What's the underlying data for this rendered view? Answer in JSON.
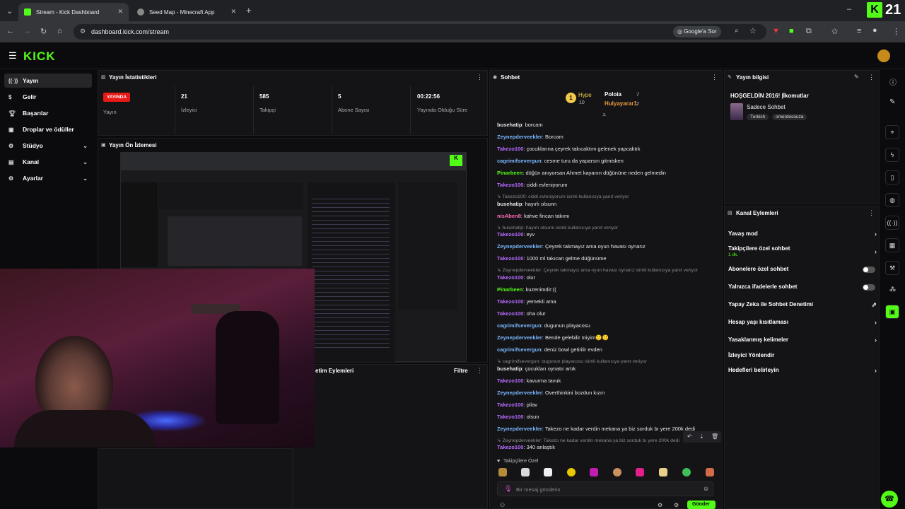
{
  "browser": {
    "tabs": [
      {
        "label": "Stream - Kick Dashboard"
      },
      {
        "label": "Seed Map - Minecraft App"
      }
    ],
    "url": "dashboard.kick.com/stream",
    "google_btn": "Google'a Sor",
    "corner_badge": "21"
  },
  "header": {
    "logo": "KICK"
  },
  "sidebar": {
    "items": [
      {
        "label": "Yayın"
      },
      {
        "label": "Gelir"
      },
      {
        "label": "Başarılar"
      },
      {
        "label": "Droplar ve ödüller"
      },
      {
        "label": "Stüdyo"
      },
      {
        "label": "Kanal"
      },
      {
        "label": "Ayarlar"
      }
    ]
  },
  "stats": {
    "title": "Yayın İstatistikleri",
    "live_badge": "YAYINDA",
    "live_label": "Yayın",
    "viewers_value": "21",
    "viewers_label": "İzleyici",
    "followers_value": "585",
    "followers_label": "Takipçi",
    "subs_value": "5",
    "subs_label": "Abone Sayısı",
    "uptime_value": "00:22:56",
    "uptime_label": "Yayında Olduğu Süre"
  },
  "preview": {
    "title": "Yayın Ön İzlemesi",
    "actions_title": "etim Eylemleri",
    "filter": "Filtre"
  },
  "chat": {
    "title": "Sohbet",
    "hype_label": "Hype",
    "hype_count": "10",
    "top1": "Poloia",
    "top1_count": "7",
    "top2": "Hulyayarar1",
    "top2_count": "2",
    "followers_only": "Takipçilere Özel",
    "input_placeholder": "Bir mesaj gönderin",
    "send": "Gönder",
    "messages": [
      {
        "user": "busehatip",
        "text": "borcam",
        "color": "#e6e6e6"
      },
      {
        "user": "Zeynepderveekler",
        "text": "Borcam",
        "color": "#79b8ff"
      },
      {
        "user": "Takezo100",
        "text": "çocuklarına çeyrek takıcaktım gelenek yapcaktık",
        "color": "#b76cff"
      },
      {
        "user": "cagrimifsevergun",
        "text": "cesme turu da yaparsın gitmisken",
        "color": "#79b8ff"
      },
      {
        "user": "Pinarbeen",
        "text": "düğün anıyorsan Ahmet kayanın düğününe neden gelmedin",
        "color": "#53fc18"
      },
      {
        "user": "Takezo100",
        "text": "ciddi evleniyorum",
        "color": "#b76cff"
      },
      {
        "user": "busehatip",
        "text": "hayırlı olsunn",
        "color": "#e6e6e6"
      },
      {
        "user": "nisAben8",
        "text": "kahve fincan takımı",
        "color": "#ff6db8"
      },
      {
        "user": "Takezo100",
        "text": "eyv",
        "color": "#b76cff"
      },
      {
        "user": "Zeynepderveekler",
        "text": "Çeyrek takmayız ama oyun havası oynarız",
        "color": "#79b8ff"
      },
      {
        "user": "Takezo100",
        "text": "1000 ml takıcan gelme düğünüme",
        "color": "#b76cff"
      },
      {
        "user": "Takezo100",
        "text": "olur",
        "color": "#b76cff"
      },
      {
        "user": "Pinarbeen",
        "text": "kuzenimdir:((",
        "color": "#53fc18"
      },
      {
        "user": "Takezo100",
        "text": "yemekli ama",
        "color": "#b76cff"
      },
      {
        "user": "Takezo100",
        "text": "oha olur",
        "color": "#b76cff"
      },
      {
        "user": "cagrimifsevergun",
        "text": "dugunun playacosu",
        "color": "#79b8ff"
      },
      {
        "user": "Zeynepderveekler",
        "text": "Bende gelebilir miyim🙂🙂",
        "color": "#79b8ff"
      },
      {
        "user": "cagrimifsevergun",
        "text": "deniz bowl getirilir evden",
        "color": "#79b8ff"
      },
      {
        "user": "busehatip",
        "text": "çocukları oynatır artık",
        "color": "#e6e6e6"
      },
      {
        "user": "Takezo100",
        "text": "kavurma tavuk",
        "color": "#b76cff"
      },
      {
        "user": "Zeynepderveekler",
        "text": "Overthinkini bozdun kızın",
        "color": "#79b8ff"
      },
      {
        "user": "Takezo100",
        "text": "pilav",
        "color": "#b76cff"
      },
      {
        "user": "Takezo100",
        "text": "olsun",
        "color": "#b76cff"
      },
      {
        "user": "Zeynepderveekler",
        "text": "Takezo ne kadar verdin mekana ya biz sorduk bı yere 200k dedi",
        "color": "#79b8ff"
      },
      {
        "user": "Takezo100",
        "text": "340 anlaştık",
        "color": "#b76cff"
      }
    ],
    "replies": [
      "Takezo100: ciddi evleniyorum isimli kullanıcıya yanıt veriyor",
      "busehatip: hayırlı olsunn isimli kullanıcıya yanıt veriyor",
      "Zeynepderveekler: Çeyrek takmayız ama oyun havası oynarız isimli kullanıcıya yanıt veriyor",
      "cagrimifsevergun: dugunun playacosu isimli kullanıcıya yanıt veriyor",
      "Zeynepderveekler: Takezo ne kadar verdin mekana ya biz sorduk bı yere 200k dedi"
    ]
  },
  "info": {
    "title": "Yayın bilgisi",
    "stream_title": "HOŞGELDİN 2016! |İkomutlar",
    "category": "Sadece Sohbet",
    "tags": [
      "Turkish",
      "omerdesouza"
    ]
  },
  "channel_actions": {
    "title": "Kanal Eylemleri",
    "items": [
      {
        "label": "Yavaş mod"
      },
      {
        "label": "Takipçilere özel sohbet"
      },
      {
        "label": "Abonelere özel sohbet"
      },
      {
        "label": "Yalnızca ifadelerle sohbet"
      },
      {
        "label": "Yapay Zeka ile Sohbet Denetimi"
      },
      {
        "label": "Hesap yaşı kısıtlaması"
      },
      {
        "label": "Yasaklanmış kelimeler"
      },
      {
        "label": "İzleyici Yönlendir"
      },
      {
        "label": "Hedefleri belirleyin"
      }
    ],
    "followers_sub": "1 dk."
  }
}
